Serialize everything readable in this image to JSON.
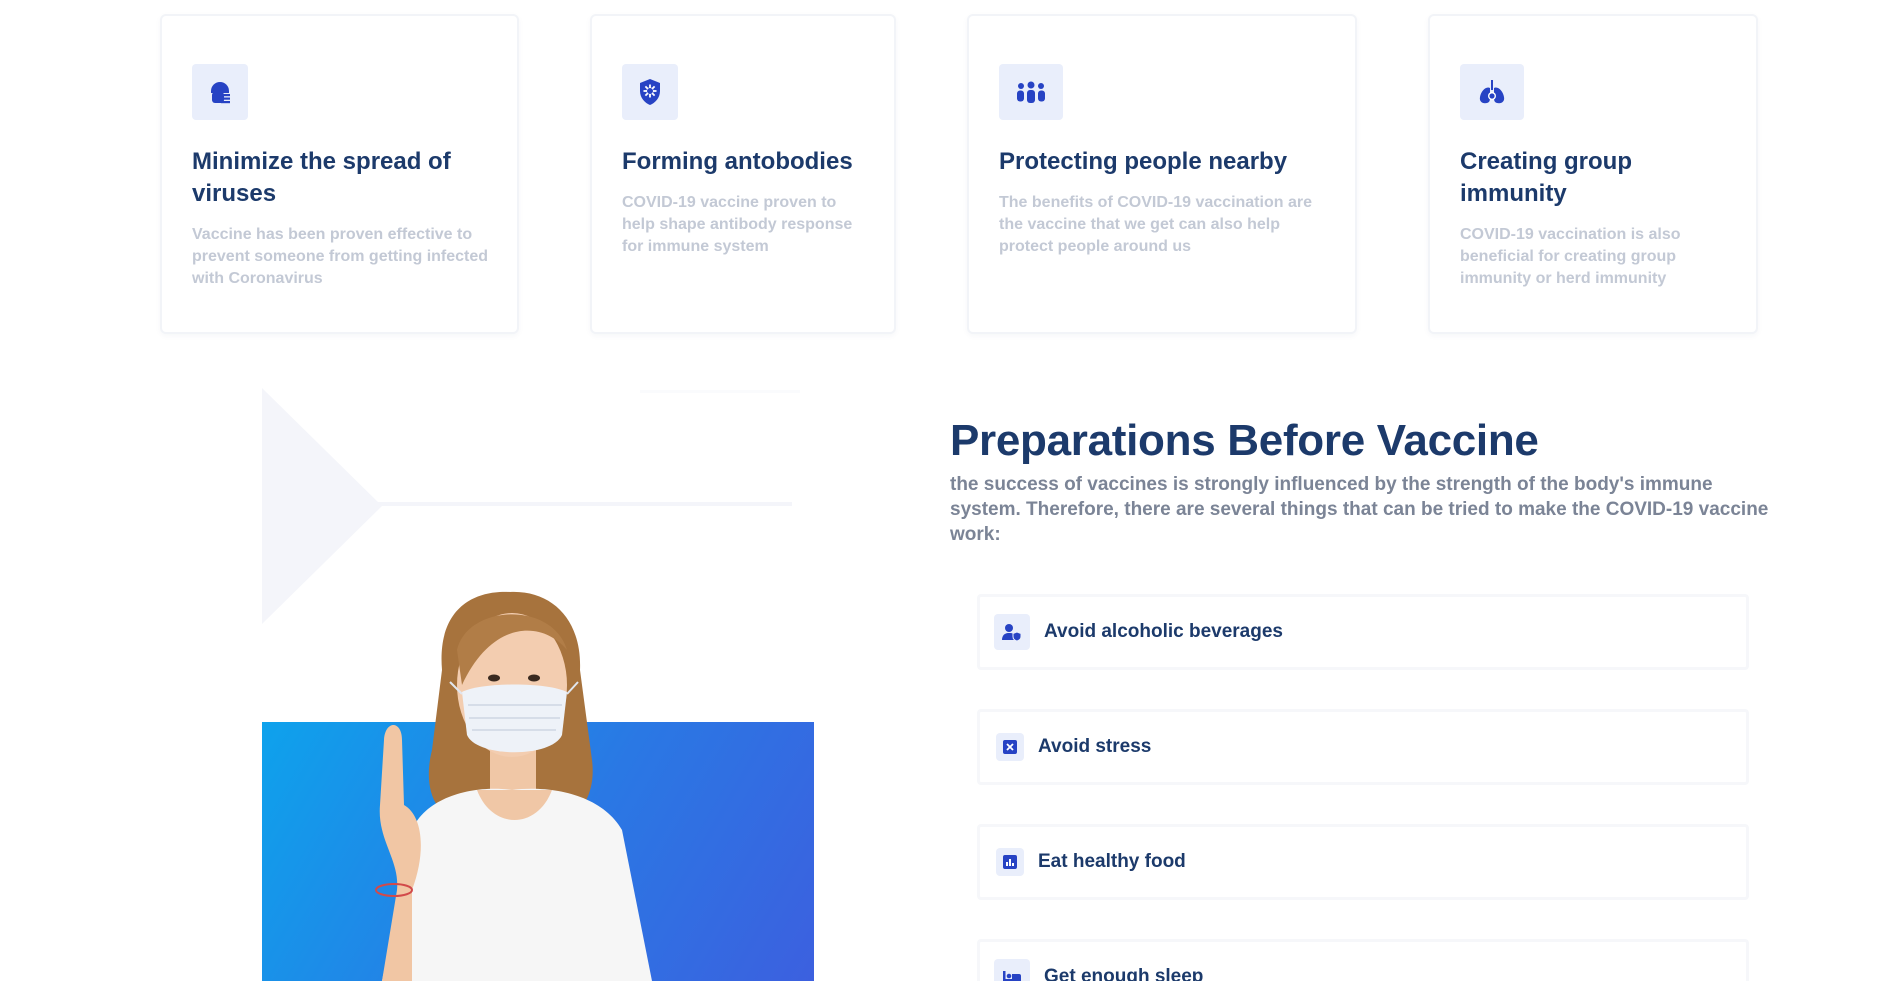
{
  "benefits": [
    {
      "icon": "face-mask-icon",
      "title": "Minimize the spread of viruses",
      "description": "Vaccine has been proven effective to prevent someone from getting infected with Coronavirus"
    },
    {
      "icon": "shield-virus-icon",
      "title": "Forming antobodies",
      "description": "COVID-19 vaccine proven to help shape antibody response for immune system"
    },
    {
      "icon": "people-group-icon",
      "title": "Protecting people nearby",
      "description": "The benefits of COVID-19 vaccination are the vaccine that we get can also help protect people around us"
    },
    {
      "icon": "lungs-virus-icon",
      "title": "Creating group immunity",
      "description": "COVID-19 vaccination is also beneficial for creating group immunity or herd immunity"
    }
  ],
  "preparations": {
    "title": "Preparations Before Vaccine",
    "description": "the success of vaccines is strongly influenced by the strength of the body's immune system. Therefore, there are several things that can be tried to make the COVID-19 vaccine work:",
    "items": [
      {
        "icon": "user-shield-icon",
        "label": "Avoid alcoholic beverages"
      },
      {
        "icon": "close-box-icon",
        "label": "Avoid stress"
      },
      {
        "icon": "bar-chart-icon",
        "label": "Eat healthy food"
      },
      {
        "icon": "bed-icon",
        "label": "Get enough sleep"
      }
    ]
  },
  "colors": {
    "heading": "#1c3a6b",
    "icon_accent": "#2743c4",
    "icon_bg": "#e9eefb",
    "muted_text": "#c3c9d5",
    "photo_gradient_start": "#0ea2ec",
    "photo_gradient_end": "#3c60df"
  }
}
